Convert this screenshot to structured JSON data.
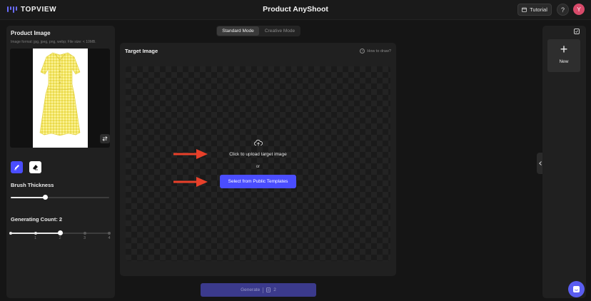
{
  "header": {
    "brand": "TOPVIEW",
    "title": "Product AnyShoot",
    "tutorial_label": "Tutorial",
    "help_label": "?",
    "avatar_initial": "Y"
  },
  "left_panel": {
    "title": "Product Image",
    "hint": "Image format: jpg, jpeg, png, webp; File size: < 10MB.",
    "brush_label": "Brush Thickness",
    "brush_value": 0.35,
    "count_label": "Generating Count: 2",
    "count_value": 2,
    "count_steps": [
      "1",
      "2",
      "3",
      "4"
    ]
  },
  "mode": {
    "standard": "Standard Mode",
    "creative": "Creative Mode",
    "selected": "Standard Mode"
  },
  "target": {
    "title": "Target Image",
    "how_link": "How to draw?",
    "upload_text": "Click to upload target image",
    "or_text": "or",
    "template_button": "Select from Public Templates"
  },
  "generate": {
    "label": "Generate",
    "credits": "2"
  },
  "right_panel": {
    "new_label": "New"
  },
  "colors": {
    "accent": "#4a4dff",
    "arrow": "#e8402a",
    "background": "#151515",
    "panel": "#202020"
  }
}
